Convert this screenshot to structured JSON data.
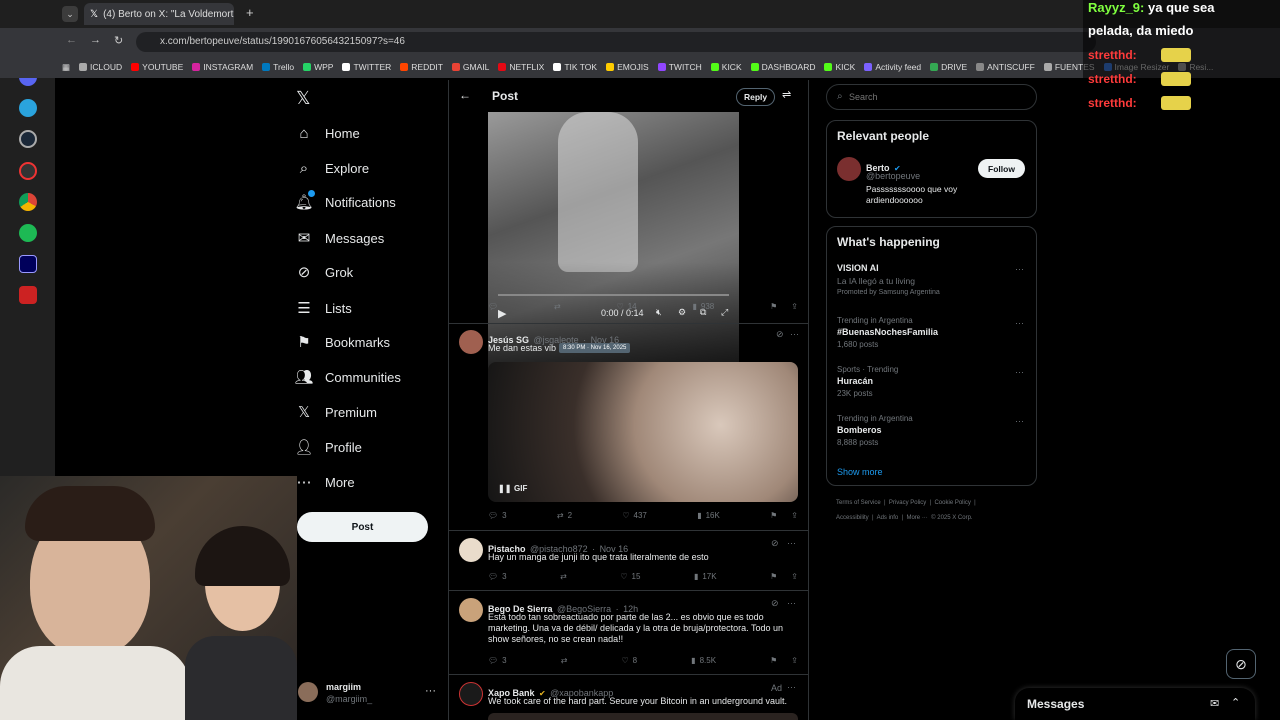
{
  "browser": {
    "tab_title": "(4) Berto on X: \"La Voldemort t",
    "url": "x.com/bertopeuve/status/1990167605643215097?s=46",
    "bookmarks": [
      "ICLOUD",
      "YOUTUBE",
      "INSTAGRAM",
      "Trello",
      "WPP",
      "TWITTER",
      "REDDIT",
      "GMAIL",
      "NETFLIX",
      "TIK TOK",
      "EMOJIS",
      "TWITCH",
      "KICK",
      "DASHBOARD",
      "KICK",
      "Activity feed",
      "DRIVE",
      "ANTISCUFF",
      "FUENTES",
      "Image Resizer",
      "Resi..."
    ]
  },
  "nav": {
    "home": "Home",
    "explore": "Explore",
    "notifications": "Notifications",
    "messages": "Messages",
    "grok": "Grok",
    "lists": "Lists",
    "bookmarks": "Bookmarks",
    "communities": "Communities",
    "premium": "Premium",
    "profile": "Profile",
    "more": "More",
    "post": "Post",
    "account": {
      "name": "margiim",
      "handle": "@margiim_"
    }
  },
  "header": {
    "title": "Post",
    "reply": "Reply"
  },
  "video": {
    "time": "0:00 / 0:14"
  },
  "tweets": [
    {
      "stats": {
        "replies": "",
        "retweets": "",
        "likes": "14",
        "views": "938"
      }
    },
    {
      "name": "Jesús SG",
      "handle": "@jsgaleote",
      "date": "Nov 16",
      "text": "Me dan estas vib",
      "tooltip": "8:30 PM · Nov 16, 2025",
      "badge": "GIF",
      "stats": {
        "replies": "3",
        "retweets": "2",
        "likes": "437",
        "views": "16K"
      }
    },
    {
      "name": "Pistacho",
      "handle": "@pistacho872",
      "date": "Nov 16",
      "text": "Hay un manga de junji ito que trata literalmente de esto",
      "stats": {
        "replies": "3",
        "retweets": "",
        "likes": "15",
        "views": "17K"
      }
    },
    {
      "name": "Bego De Sierra",
      "handle": "@BegoSierra",
      "date": "12h",
      "text": "Está todo tan sobreactuado por parte de las 2... es obvio que es todo marketing. Una va de débil/ delicada y la otra de bruja/protectora. Todo un show señores, no se crean nada!!",
      "stats": {
        "replies": "3",
        "retweets": "",
        "likes": "8",
        "views": "8.5K"
      }
    },
    {
      "name": "Xapo Bank",
      "handle": "@xapobankapp",
      "ad": "Ad",
      "text": "We took care of the hard part. Secure your Bitcoin in an underground vault."
    }
  ],
  "search": {
    "placeholder": "Search"
  },
  "relevant": {
    "title": "Relevant people",
    "name": "Berto",
    "handle": "@bertopeuve",
    "bio": "Passsssssoooo que voy ardiendoooooo",
    "follow": "Follow"
  },
  "happening": {
    "title": "What's happening",
    "items": [
      {
        "title": "VISION AI",
        "sub": "La IA llegó a tu living",
        "promo": "Promoted by Samsung Argentina"
      },
      {
        "context": "Trending in Argentina",
        "title": "#BuenasNochesFamilia",
        "count": "1,680 posts"
      },
      {
        "context": "Sports · Trending",
        "title": "Huracán",
        "count": "23K posts"
      },
      {
        "context": "Trending in Argentina",
        "title": "Bomberos",
        "count": "8,888 posts"
      }
    ],
    "show_more": "Show more"
  },
  "footer": {
    "l1": "Terms of Service  |  Privacy Policy  |  Cookie Policy  |",
    "l2": "Accessibility  |  Ads info  |  More ···  © 2025 X Corp."
  },
  "messages_dock": "Messages",
  "chat": {
    "user": "Rayyz_9:",
    "msg1": "ya que sea",
    "msg2": "pelada, da miedo",
    "user2": "stretthd:"
  }
}
